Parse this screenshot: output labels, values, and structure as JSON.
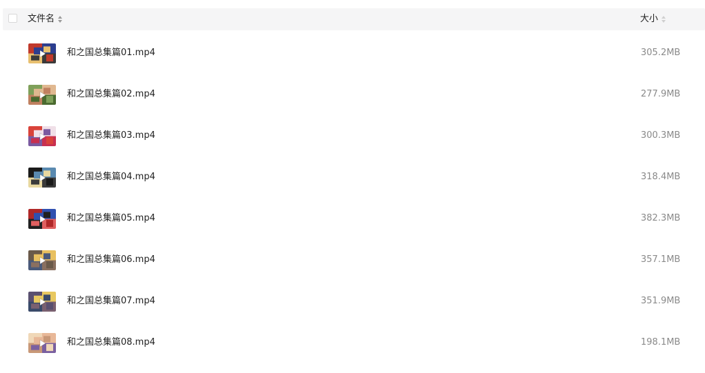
{
  "header": {
    "name_label": "文件名",
    "size_label": "大小"
  },
  "files": [
    {
      "name": "和之国总集篇01.mp4",
      "size": "305.2MB",
      "thumb_colors": [
        "#c0392b",
        "#2c3e8f",
        "#e8c070",
        "#3a3a3a"
      ]
    },
    {
      "name": "和之国总集篇02.mp4",
      "size": "277.9MB",
      "thumb_colors": [
        "#7fa05a",
        "#e0b890",
        "#c08060",
        "#4a6a30"
      ]
    },
    {
      "name": "和之国总集篇03.mp4",
      "size": "300.3MB",
      "thumb_colors": [
        "#d9433a",
        "#f0e0e8",
        "#7a5aa0",
        "#c83050"
      ]
    },
    {
      "name": "和之国总集篇04.mp4",
      "size": "318.4MB",
      "thumb_colors": [
        "#1a1a1a",
        "#5a8ab0",
        "#e8d8a0",
        "#3a3a3a"
      ]
    },
    {
      "name": "和之国总集篇05.mp4",
      "size": "382.3MB",
      "thumb_colors": [
        "#b02828",
        "#3050b0",
        "#202020",
        "#e06060"
      ]
    },
    {
      "name": "和之国总集篇06.mp4",
      "size": "357.1MB",
      "thumb_colors": [
        "#6a5a4a",
        "#e8c060",
        "#4a5a7a",
        "#8a7060"
      ]
    },
    {
      "name": "和之国总集篇07.mp4",
      "size": "351.9MB",
      "thumb_colors": [
        "#5a5070",
        "#e8c860",
        "#3a4a6a",
        "#7a6070"
      ]
    },
    {
      "name": "和之国总集篇08.mp4",
      "size": "198.1MB",
      "thumb_colors": [
        "#f0d8b8",
        "#e8b898",
        "#c89878",
        "#7a60a0"
      ]
    }
  ]
}
